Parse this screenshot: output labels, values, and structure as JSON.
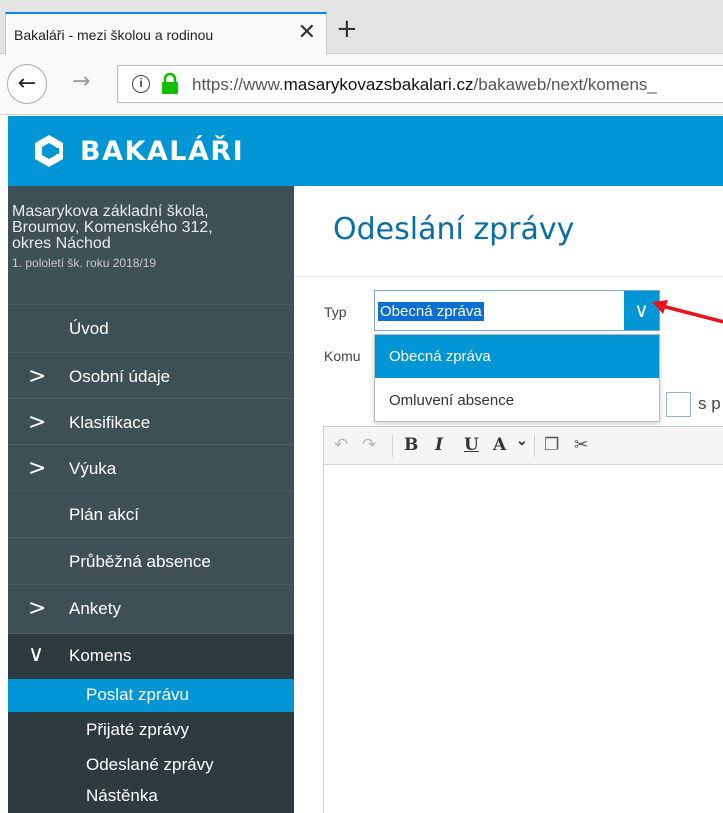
{
  "browser": {
    "tab_title": "Bakaláři - mezi školou a rodinou",
    "tab_close": "✕",
    "new_tab": "+",
    "back": "←",
    "forward": "→",
    "url_prefix": "https://www.",
    "url_domain": "masarykovazsbakalari.cz",
    "url_path": "/bakaweb/next/komens_"
  },
  "header": {
    "logo_text": "BAKALÁŘI",
    "brand_color": "#0096d6"
  },
  "sidebar": {
    "school_line1": "Masarykova základní škola,",
    "school_line2": "Broumov, Komenského 312,",
    "school_line3": "okres Náchod",
    "term": "1. pololetí šk. roku 2018/19",
    "items": [
      {
        "label": "Úvod",
        "chevron": ""
      },
      {
        "label": "Osobní údaje",
        "chevron": ">"
      },
      {
        "label": "Klasifikace",
        "chevron": ">"
      },
      {
        "label": "Výuka",
        "chevron": ">"
      },
      {
        "label": "Plán akcí",
        "chevron": ""
      },
      {
        "label": "Průběžná absence",
        "chevron": ""
      },
      {
        "label": "Ankety",
        "chevron": ">"
      },
      {
        "label": "Komens",
        "chevron": "∨"
      }
    ],
    "sub_items": [
      {
        "label": "Poslat zprávu",
        "selected": true
      },
      {
        "label": "Přijaté zprávy"
      },
      {
        "label": "Odeslané zprávy"
      },
      {
        "label": "Nástěnka"
      }
    ]
  },
  "main": {
    "page_title": "Odeslání zprávy",
    "type_label": "Typ",
    "to_label": "Komu",
    "type_selected": "Obecná zpráva",
    "select_arrow": "∨",
    "dropdown_options": [
      "Obecná zpráva",
      "Omluvení absence"
    ],
    "checkbox_label": "s p"
  },
  "toolbar": {
    "undo": "↶",
    "redo": "↷",
    "bold": "B",
    "italic": "I",
    "underline": "U",
    "font_color": "A",
    "font_color_dropdown": "⌄",
    "copy": "❐",
    "cut": "✂"
  }
}
